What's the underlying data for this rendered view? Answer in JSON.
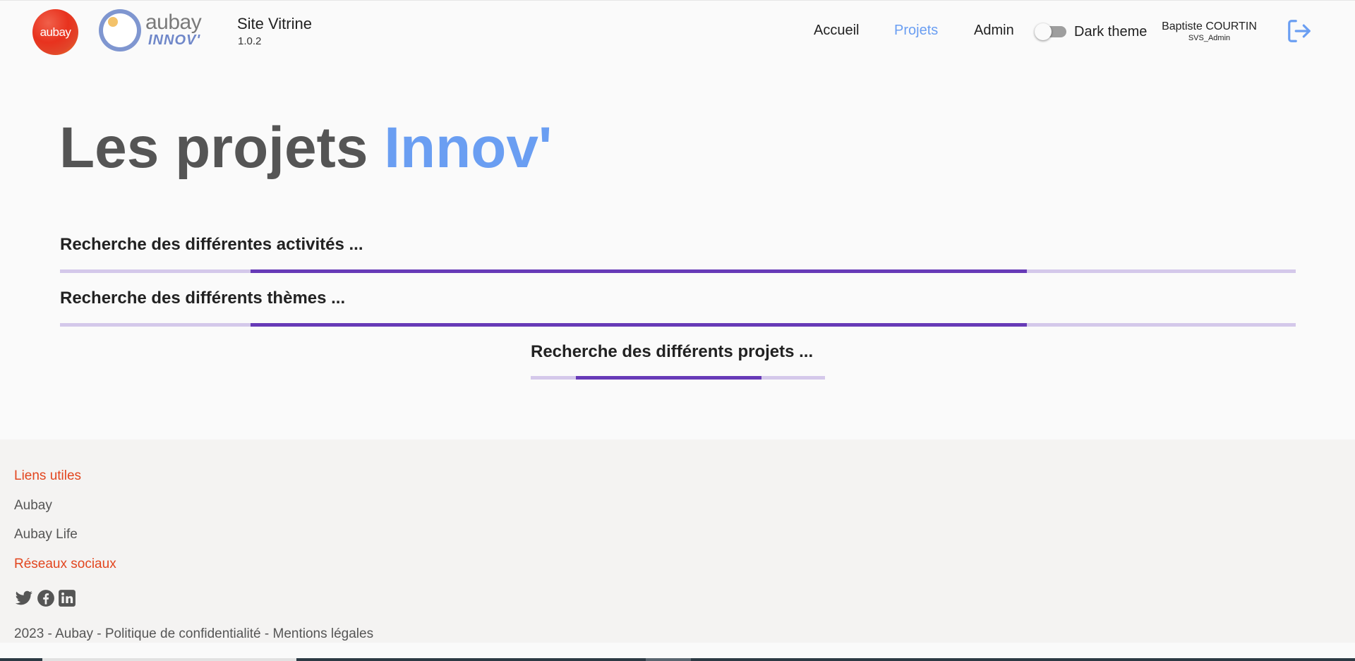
{
  "header": {
    "logo_text": "aubay",
    "innov_logo_word": "aubay",
    "innov_logo_sub": "INNOV'",
    "site_title": "Site Vitrine",
    "version": "1.0.2",
    "nav": {
      "home": "Accueil",
      "projects": "Projets",
      "admin": "Admin"
    },
    "active_nav": "Projets",
    "dark_theme_label": "Dark theme",
    "dark_theme_enabled": false,
    "user_name": "Baptiste COURTIN",
    "user_role": "SVS_Admin",
    "logout_icon": "logout-icon"
  },
  "main": {
    "title_part1": "Les projets",
    "title_accent": "Innov'",
    "loaders": [
      {
        "label": "Recherche des différentes activités ..."
      },
      {
        "label": "Recherche des différents thèmes ..."
      },
      {
        "label": "Recherche des différents projets ..."
      }
    ]
  },
  "footer": {
    "useful_links_heading": "Liens utiles",
    "links": [
      "Aubay",
      "Aubay Life"
    ],
    "social_heading": "Réseaux sociaux",
    "social_icons": [
      "twitter-icon",
      "facebook-icon",
      "linkedin-icon"
    ],
    "legal": "2023 - Aubay - Politique de confidentialité - Mentions légales"
  },
  "colors": {
    "accent": "#6a9ef2",
    "progress": "#673ab7",
    "progress_track": "#d4c8ea",
    "footer_heading": "#e2461f"
  }
}
